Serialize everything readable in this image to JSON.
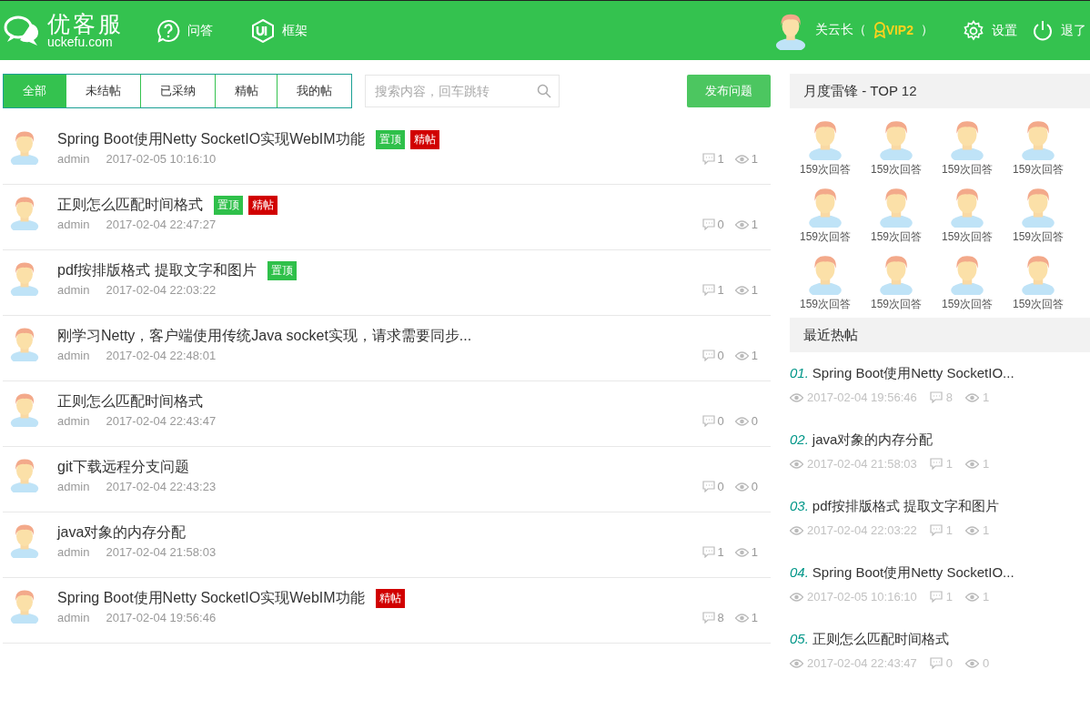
{
  "header": {
    "logo": {
      "name": "优客服",
      "domain": "uckefu.com"
    },
    "nav": [
      {
        "label": "问答",
        "kind": "question"
      },
      {
        "label": "框架",
        "kind": "ui"
      }
    ],
    "user": {
      "name": "关云长（",
      "vip": "VIP2",
      "close": "）"
    },
    "actions": [
      {
        "label": "设置",
        "kind": "settings"
      },
      {
        "label": "退了",
        "kind": "power"
      }
    ]
  },
  "filters": [
    {
      "label": "全部",
      "selected": true
    },
    {
      "label": "未结帖",
      "selected": false
    },
    {
      "label": "已采纳",
      "selected": false
    },
    {
      "label": "精帖",
      "selected": false
    },
    {
      "label": "我的帖",
      "selected": false
    }
  ],
  "search": {
    "placeholder": "搜索内容，回车跳转"
  },
  "publish_button": "发布问题",
  "posts": [
    {
      "title": "Spring Boot使用Netty SocketIO实现WebIM功能",
      "tags": [
        {
          "text": "置顶",
          "kind": "top"
        },
        {
          "text": "精帖",
          "kind": "featured"
        }
      ],
      "author": "admin",
      "time": "2017-02-05 10:16:10",
      "comments": "1",
      "views": "1"
    },
    {
      "title": "正则怎么匹配时间格式",
      "tags": [
        {
          "text": "置顶",
          "kind": "top"
        },
        {
          "text": "精帖",
          "kind": "featured"
        }
      ],
      "author": "admin",
      "time": "2017-02-04 22:47:27",
      "comments": "0",
      "views": "1"
    },
    {
      "title": "pdf按排版格式 提取文字和图片",
      "tags": [
        {
          "text": "置顶",
          "kind": "top"
        }
      ],
      "author": "admin",
      "time": "2017-02-04 22:03:22",
      "comments": "1",
      "views": "1"
    },
    {
      "title": "刚学习Netty，客户端使用传统Java socket实现，请求需要同步...",
      "author": "admin",
      "time": "2017-02-04 22:48:01",
      "comments": "0",
      "views": "1"
    },
    {
      "title": "正则怎么匹配时间格式",
      "author": "admin",
      "time": "2017-02-04 22:43:47",
      "comments": "0",
      "views": "0"
    },
    {
      "title": "git下载远程分支问题",
      "author": "admin",
      "time": "2017-02-04 22:43:23",
      "comments": "0",
      "views": "0"
    },
    {
      "title": "java对象的内存分配",
      "author": "admin",
      "time": "2017-02-04 21:58:03",
      "comments": "1",
      "views": "1"
    },
    {
      "title": "Spring Boot使用Netty SocketIO实现WebIM功能",
      "tags": [
        {
          "text": "精帖",
          "kind": "featured"
        }
      ],
      "author": "admin",
      "time": "2017-02-04 19:56:46",
      "comments": "8",
      "views": "1"
    }
  ],
  "top_users": {
    "title": "月度雷锋 - TOP 12",
    "users": [
      {
        "label": "159次回答"
      },
      {
        "label": "159次回答"
      },
      {
        "label": "159次回答"
      },
      {
        "label": "159次回答"
      },
      {
        "label": "159次回答"
      },
      {
        "label": "159次回答"
      },
      {
        "label": "159次回答"
      },
      {
        "label": "159次回答"
      },
      {
        "label": "159次回答"
      },
      {
        "label": "159次回答"
      },
      {
        "label": "159次回答"
      },
      {
        "label": "159次回答"
      }
    ]
  },
  "hot_posts": {
    "title": "最近热帖",
    "items": [
      {
        "rank": "01.",
        "title": "Spring Boot使用Netty SocketIO...",
        "time": "2017-02-04 19:56:46",
        "comments": "8",
        "views": "1"
      },
      {
        "rank": "02.",
        "title": "java对象的内存分配",
        "time": "2017-02-04 21:58:03",
        "comments": "1",
        "views": "1"
      },
      {
        "rank": "03.",
        "title": "pdf按排版格式 提取文字和图片",
        "time": "2017-02-04 22:03:22",
        "comments": "1",
        "views": "1"
      },
      {
        "rank": "04.",
        "title": "Spring Boot使用Netty SocketIO...",
        "time": "2017-02-05 10:16:10",
        "comments": "1",
        "views": "1"
      },
      {
        "rank": "05.",
        "title": "正则怎么匹配时间格式",
        "time": "2017-02-04 22:43:47",
        "comments": "0",
        "views": "0"
      }
    ]
  }
}
